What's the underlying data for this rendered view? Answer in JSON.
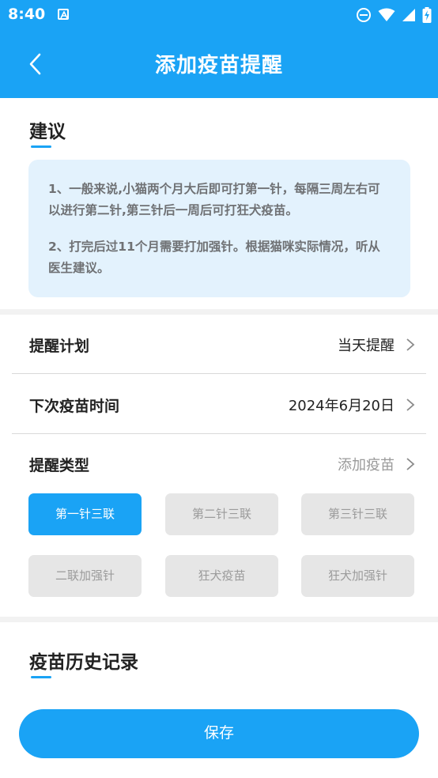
{
  "status_bar": {
    "time": "8:40",
    "icons": [
      "app-notification-icon",
      "do-not-disturb-icon",
      "wifi-icon",
      "signal-icon",
      "battery-charging-icon"
    ]
  },
  "header": {
    "title": "添加疫苗提醒",
    "back_icon": "chevron-left-icon"
  },
  "advice": {
    "title": "建议",
    "paragraphs": [
      "1、一般来说,小猫两个月大后即可打第一针，每隔三周左右可以进行第二针,第三针后一周后可打狂犬疫苗。",
      "2、打完后过11个月需要打加强针。根据猫咪实际情况，听从医生建议。"
    ]
  },
  "settings": {
    "reminder_plan": {
      "label": "提醒计划",
      "value": "当天提醒"
    },
    "next_vaccine_time": {
      "label": "下次疫苗时间",
      "value": "2024年6月20日"
    },
    "reminder_type": {
      "label": "提醒类型",
      "value": "添加疫苗"
    }
  },
  "vaccine_options": [
    {
      "label": "第一针三联",
      "selected": true
    },
    {
      "label": "第二针三联",
      "selected": false
    },
    {
      "label": "第三针三联",
      "selected": false
    },
    {
      "label": "二联加强针",
      "selected": false
    },
    {
      "label": "狂犬疫苗",
      "selected": false
    },
    {
      "label": "狂犬加强针",
      "selected": false
    }
  ],
  "history": {
    "title": "疫苗历史记录"
  },
  "save_label": "保存",
  "colors": {
    "accent": "#1aa3f5",
    "advice_bg": "#e3f2fd",
    "chip_inactive": "#e6e6e6"
  }
}
